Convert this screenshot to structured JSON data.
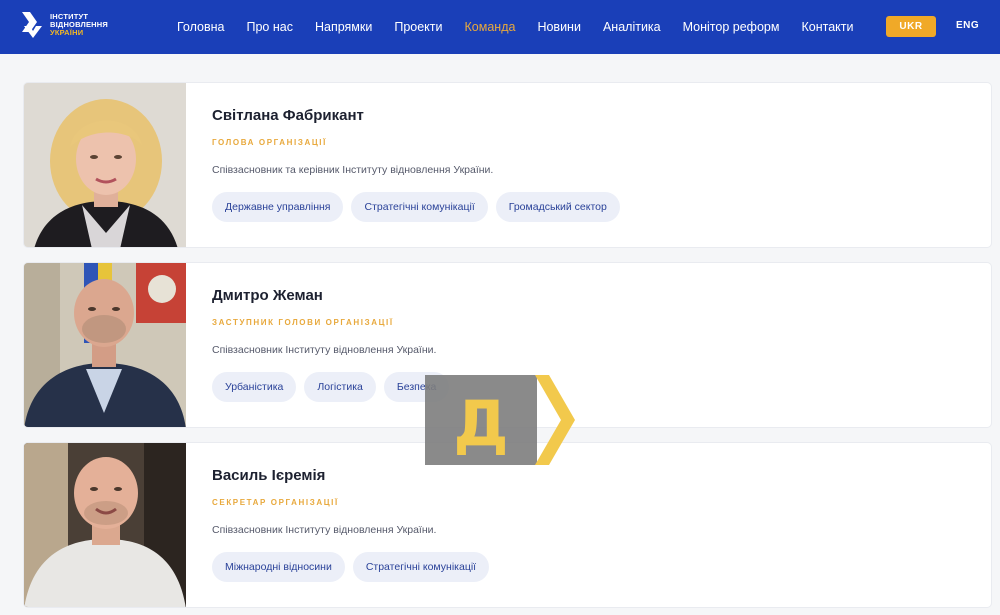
{
  "logo": {
    "line1": "ІНСТИТУТ",
    "line2": "ВІДНОВЛЕННЯ",
    "line3": "УКРАЇНИ"
  },
  "nav": {
    "items": [
      {
        "label": "Головна",
        "active": false
      },
      {
        "label": "Про нас",
        "active": false
      },
      {
        "label": "Напрямки",
        "active": false
      },
      {
        "label": "Проекти",
        "active": false
      },
      {
        "label": "Команда",
        "active": true
      },
      {
        "label": "Новини",
        "active": false
      },
      {
        "label": "Аналітика",
        "active": false
      },
      {
        "label": "Монітор реформ",
        "active": false
      },
      {
        "label": "Контакти",
        "active": false
      }
    ],
    "lang_active": "UKR",
    "lang_other": "ENG"
  },
  "team": [
    {
      "name": "Світлана Фабрикант",
      "role": "ГОЛОВА ОРГАНІЗАЦІЇ",
      "description": "Співзасновник та керівник Інституту відновлення України.",
      "tags": [
        "Державне управління",
        "Стратегічні комунікації",
        "Громадський сектор"
      ]
    },
    {
      "name": "Дмитро Жеман",
      "role": "ЗАСТУПНИК ГОЛОВИ ОРГАНІЗАЦІЇ",
      "description": "Співзасновник Інституту відновлення України.",
      "tags": [
        "Урбаністика",
        "Логістика",
        "Безпека"
      ]
    },
    {
      "name": "Василь Ієремія",
      "role": "СЕКРЕТАР ОРГАНІЗАЦІЇ",
      "description": "Співзасновник Інституту відновлення України.",
      "tags": [
        "Міжнародні відносини",
        "Стратегічні комунікації"
      ]
    }
  ],
  "watermark": {
    "letter": "Д"
  },
  "colors": {
    "nav_bg": "#1a3fb8",
    "accent": "#e8a93d",
    "tag_bg": "#eceff8",
    "tag_text": "#2a4299"
  }
}
